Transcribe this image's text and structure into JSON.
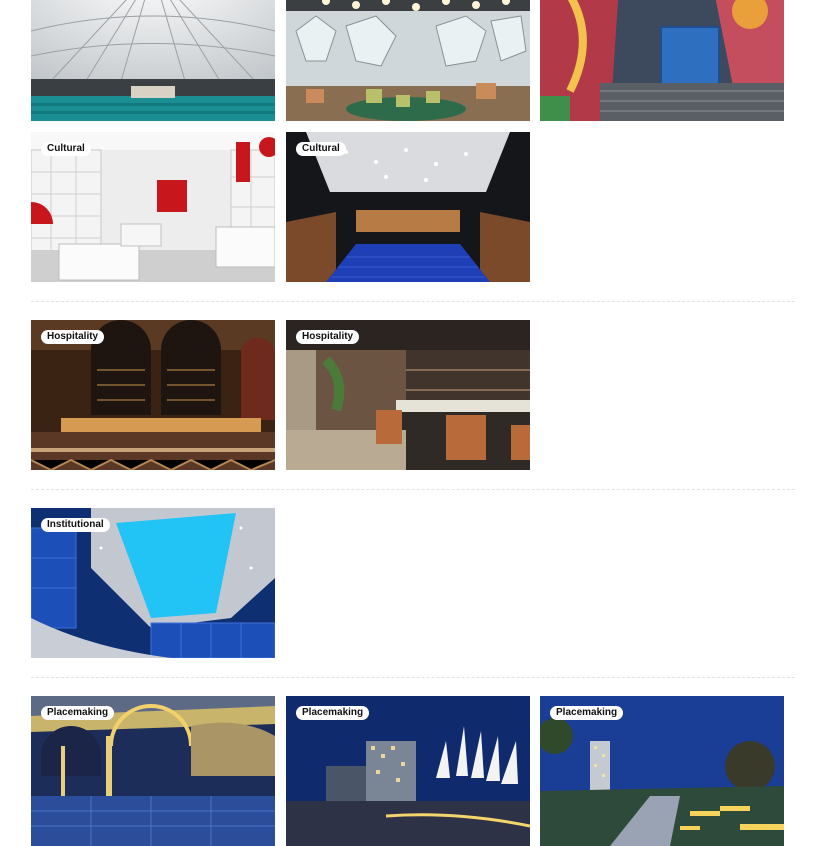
{
  "projects": {
    "cultural": [
      {
        "name": "dome-auditorium"
      },
      {
        "name": "library-lounge"
      },
      {
        "name": "mural-alcove"
      },
      {
        "name": "red-gallery",
        "category": "Cultural"
      },
      {
        "name": "blue-seat-theater",
        "category": "Cultural"
      }
    ],
    "hospitality": [
      {
        "name": "arched-bar",
        "category": "Hospitality"
      },
      {
        "name": "restaurant-bar",
        "category": "Hospitality"
      }
    ],
    "institutional": [
      {
        "name": "blue-ceiling-atrium",
        "category": "Institutional"
      }
    ],
    "placemaking": [
      {
        "name": "lit-bridge",
        "category": "Placemaking"
      },
      {
        "name": "city-plaza",
        "category": "Placemaking"
      },
      {
        "name": "tower-park",
        "category": "Placemaking"
      }
    ]
  }
}
